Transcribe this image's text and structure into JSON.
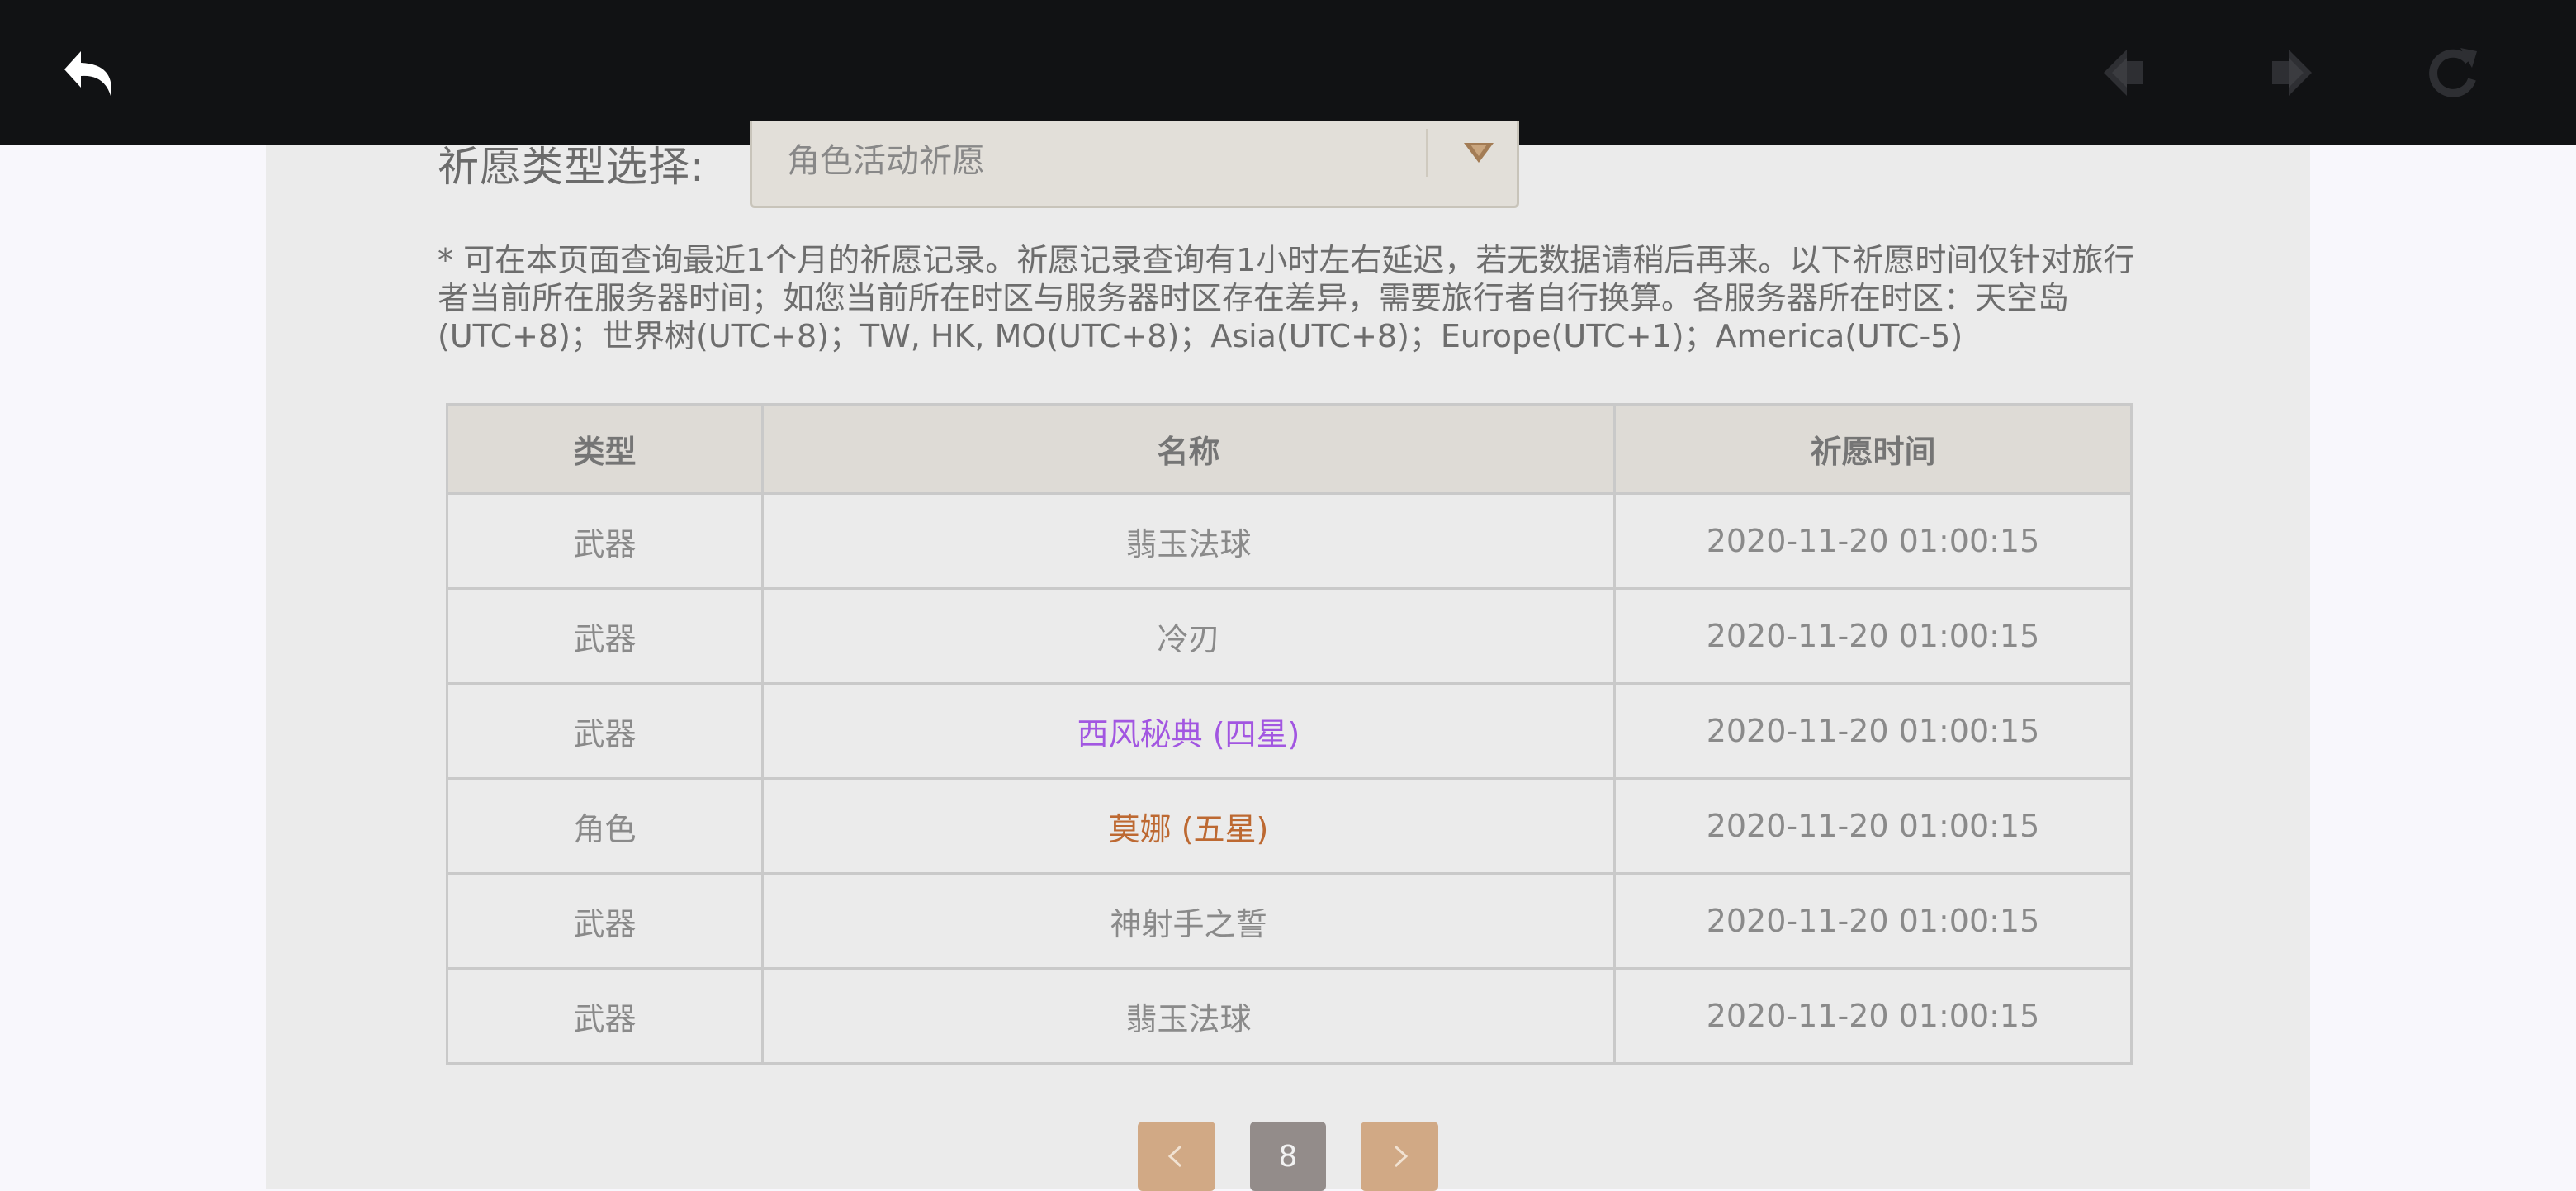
{
  "topbar": {
    "back_icon": "undo-arrow-icon",
    "prev_icon": "diamond-left-icon",
    "next_icon": "diamond-right-icon",
    "refresh_icon": "refresh-icon"
  },
  "filter": {
    "label": "祈愿类型选择:",
    "selected": "角色活动祈愿",
    "arrow_icon": "chevron-down-icon"
  },
  "notice": "* 可在本页面查询最近1个月的祈愿记录。祈愿记录查询有1小时左右延迟，若无数据请稍后再来。以下祈愿时间仅针对旅行者当前所在服务器时间；如您当前所在时区与服务器时区存在差异，需要旅行者自行换算。各服务器所在时区：天空岛(UTC+8)；世界树(UTC+8)；TW, HK, MO(UTC+8)；Asia(UTC+8)；Europe(UTC+1)；America(UTC-5)",
  "table": {
    "headers": [
      "类型",
      "名称",
      "祈愿时间"
    ],
    "rows": [
      {
        "type": "武器",
        "name": "翡玉法球",
        "time": "2020-11-20 01:00:15"
      },
      {
        "type": "武器",
        "name": "冷刃",
        "time": "2020-11-20 01:00:15"
      },
      {
        "type": "武器",
        "name": "西风秘典 (四星)",
        "time": "2020-11-20 01:00:15"
      },
      {
        "type": "角色",
        "name": "莫娜 (五星)",
        "time": "2020-11-20 01:00:15"
      },
      {
        "type": "武器",
        "name": "神射手之誓",
        "time": "2020-11-20 01:00:15"
      },
      {
        "type": "武器",
        "name": "翡玉法球",
        "time": "2020-11-20 01:00:15"
      }
    ]
  },
  "pagination": {
    "current_page": "8",
    "prev_icon": "chevron-left-icon",
    "next_icon": "chevron-right-icon"
  },
  "colors": {
    "four_star": "#a256e1",
    "five_star": "#bd6932",
    "pager_nav": "#d1a985",
    "pager_current": "#938c8a"
  }
}
